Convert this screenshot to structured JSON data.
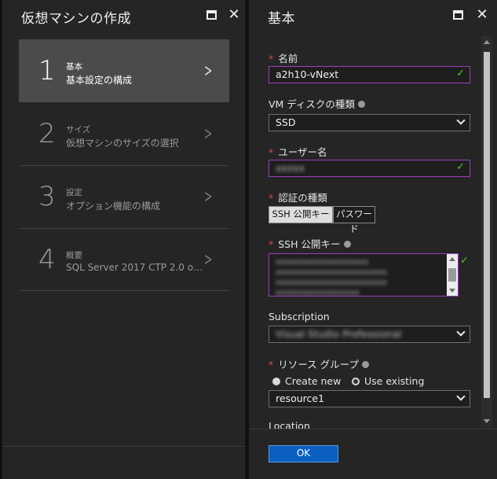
{
  "left_blade": {
    "title": "仮想マシンの作成",
    "steps": [
      {
        "number": "1",
        "caption": "基本",
        "description": "基本設定の構成",
        "active": true
      },
      {
        "number": "2",
        "caption": "サイズ",
        "description": "仮想マシンのサイズの選択",
        "active": false
      },
      {
        "number": "3",
        "caption": "設定",
        "description": "オプション機能の構成",
        "active": false
      },
      {
        "number": "4",
        "caption": "概要",
        "description": "SQL Server 2017 CTP 2.0 o…",
        "active": false
      }
    ]
  },
  "right_blade": {
    "title": "基本",
    "form": {
      "name": {
        "label": "名前",
        "required": true,
        "value": "a2h10-vNext"
      },
      "disk_type": {
        "label": "VM ディスクの種類",
        "value": "SSD"
      },
      "username": {
        "label": "ユーザー名",
        "required": true,
        "value": "xxxxx"
      },
      "auth_type": {
        "label": "認証の種類",
        "required": true,
        "options": [
          "SSH 公開キー",
          "パスワード"
        ],
        "selected": "SSH 公開キー"
      },
      "ssh_key": {
        "label": "SSH 公開キー",
        "required": true,
        "lines": [
          "xxxxxxxxxxxxxxxxxxxx",
          "xxxxxxxxxxxxxxxxxxxxxxxx",
          "xxxxxxxxxxxxxxxxxxxxxxxx",
          "xxxxxxxxxxxxxxxxxx"
        ]
      },
      "subscription": {
        "label": "Subscription",
        "value": "Visual Studio Professional"
      },
      "resource_group": {
        "label": "リソース グループ",
        "required": true,
        "radio_options": [
          "Create new",
          "Use existing"
        ],
        "selected": "Use existing",
        "value": "resource1"
      },
      "location": {
        "label": "Location"
      }
    },
    "ok_label": "OK"
  },
  "colors": {
    "accent": "#0a5fbf",
    "valid_border": "#9b3fc0",
    "valid_check": "#57c22f",
    "required": "#e3453c"
  }
}
